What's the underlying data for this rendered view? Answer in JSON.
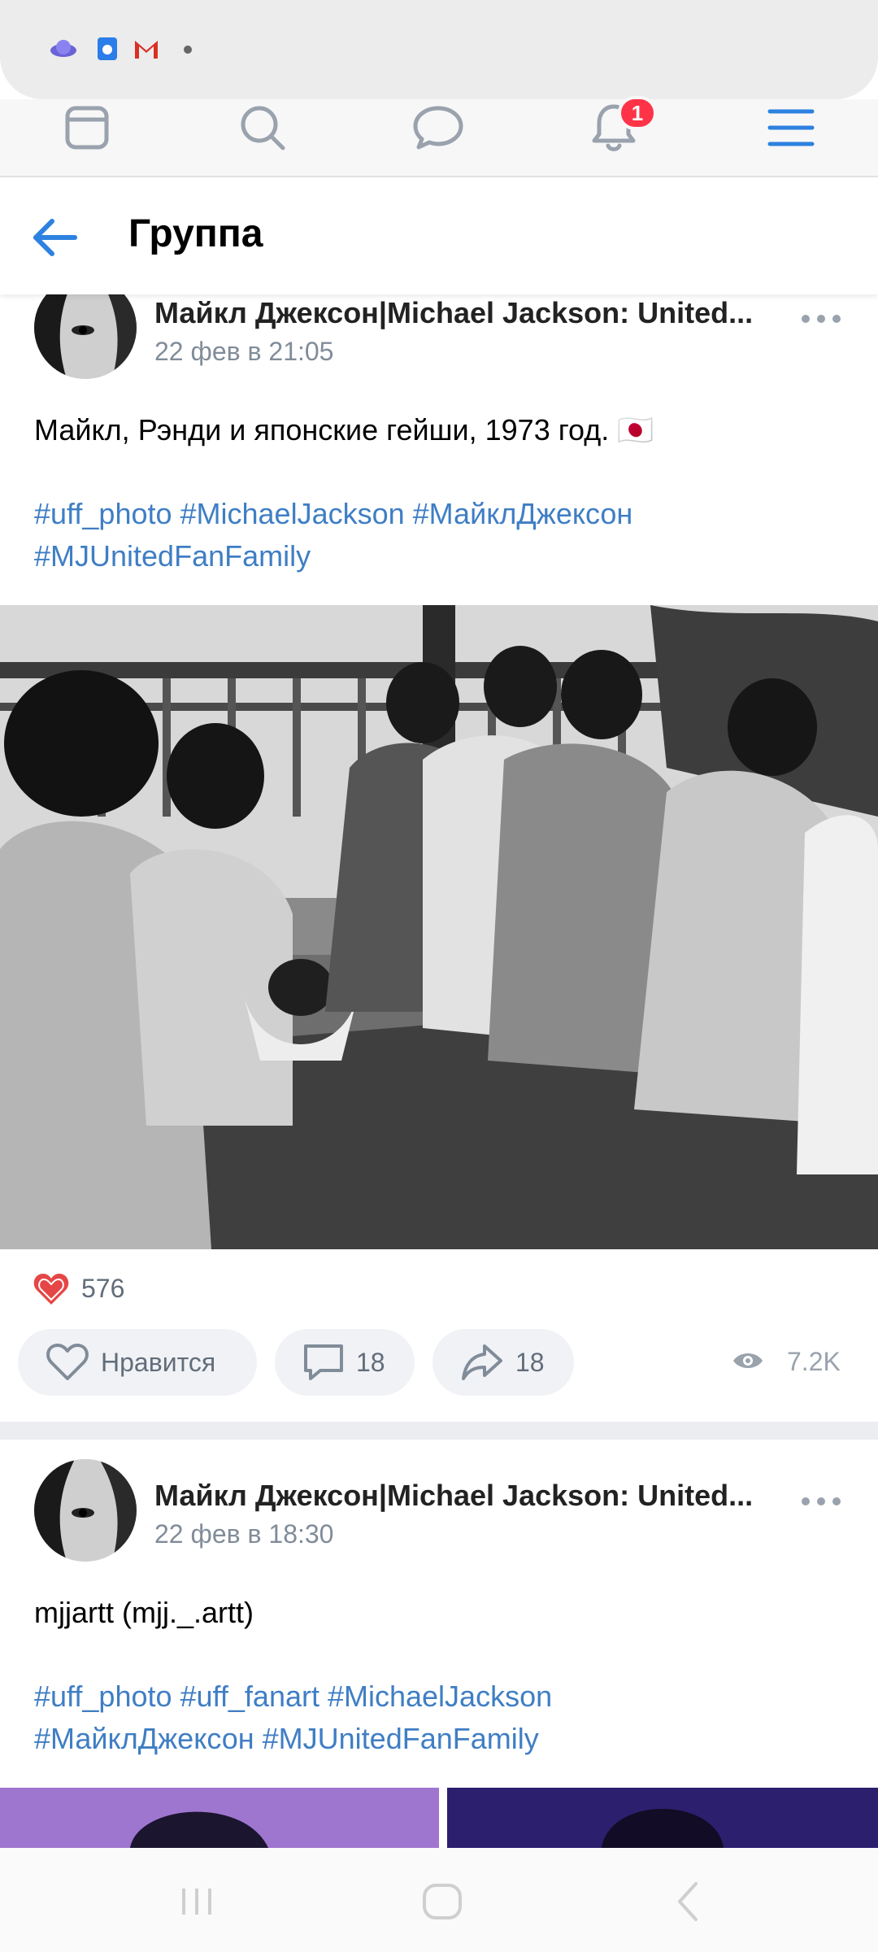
{
  "status_bar": {
    "icons": [
      "browser-planet-icon",
      "calendar-app-icon",
      "gmail-icon",
      "notification-dot-icon"
    ]
  },
  "top_nav": {
    "items": [
      {
        "name": "feed-icon"
      },
      {
        "name": "search-icon"
      },
      {
        "name": "messages-icon"
      },
      {
        "name": "notifications-icon"
      },
      {
        "name": "menu-icon"
      }
    ],
    "notifications_badge": "1"
  },
  "header": {
    "title": "Группа"
  },
  "posts": [
    {
      "author": "Майкл Джексон|Michael Jackson: United...",
      "date": "22 фев в 21:05",
      "text": "Майкл, Рэнди и японские гейши, 1973 год. 🇯🇵",
      "hashtags_line1": "#uff_photo #MichaelJackson #МайклДжексон",
      "hashtags_line2": "#MJUnitedFanFamily",
      "likes_count": "576",
      "like_label": "Нравится",
      "comments_count": "18",
      "shares_count": "18",
      "views_count": "7.2K"
    },
    {
      "author": "Майкл Джексон|Michael Jackson: United...",
      "date": "22 фев в 18:30",
      "text": "mjjartt (mjj._.artt)",
      "hashtags_line1": "#uff_photo #uff_fanart #MichaelJackson",
      "hashtags_line2": "#МайклДжексон #MJUnitedFanFamily"
    }
  ],
  "colors": {
    "accent": "#2d81e0",
    "link": "#3f7ec4",
    "badge": "#ff3347",
    "like_red": "#e64646",
    "secondary_text": "#818c99"
  }
}
